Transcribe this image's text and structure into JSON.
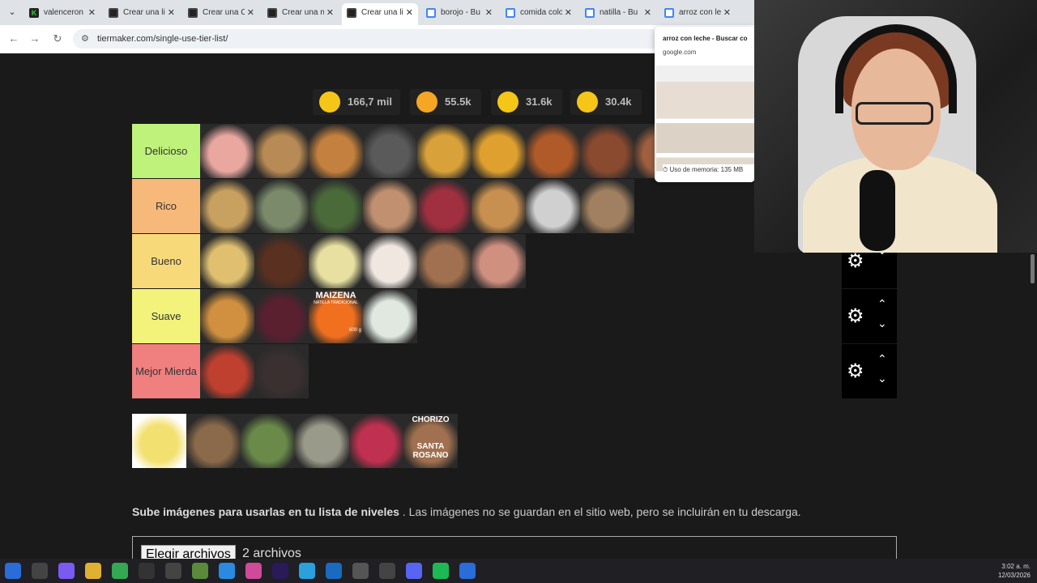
{
  "browser": {
    "tabs": [
      {
        "title": "valenceron",
        "favicon": "k-icon",
        "active": false
      },
      {
        "title": "Crear una li",
        "favicon": "tiermaker-icon",
        "active": false
      },
      {
        "title": "Crear una C",
        "favicon": "tiermaker-icon",
        "active": false
      },
      {
        "title": "Crear una n",
        "favicon": "tiermaker-icon",
        "active": false
      },
      {
        "title": "Crear una li",
        "favicon": "tiermaker-icon",
        "active": true
      },
      {
        "title": "borojo - Bu",
        "favicon": "google-icon",
        "active": false
      },
      {
        "title": "comida colo",
        "favicon": "google-icon",
        "active": false
      },
      {
        "title": "natilla - Bu",
        "favicon": "google-icon",
        "active": false
      },
      {
        "title": "arroz con le",
        "favicon": "google-icon",
        "active": false
      }
    ],
    "url": "tiermaker.com/single-use-tier-list/",
    "tab_preview": {
      "title": "arroz con leche - Buscar co",
      "domain": "google.com",
      "memory": "Uso de memoria: 135 MB"
    }
  },
  "reactions": [
    {
      "emoji": "smile-emoji-icon",
      "count": "166,7 mil",
      "color": "#f5c518"
    },
    {
      "emoji": "heart-eyes-emoji-icon",
      "count": "55.5k",
      "color": "#f5a623"
    },
    {
      "emoji": "laughing-emoji-icon",
      "count": "31.6k",
      "color": "#f5c518"
    },
    {
      "emoji": "raised-hands-emoji-icon",
      "count": "30.4k",
      "color": "#f5c518"
    }
  ],
  "tiers": [
    {
      "label": "Delicioso",
      "color": "#bff27a",
      "items": 9
    },
    {
      "label": "Rico",
      "color": "#f7b97a",
      "items": 8
    },
    {
      "label": "Bueno",
      "color": "#f7d97a",
      "items": 6
    },
    {
      "label": "Suave",
      "color": "#f3f27a",
      "items": 4
    },
    {
      "label": "Mejor Mierda",
      "color": "#f07f7f",
      "items": 2
    }
  ],
  "tier_controls": {
    "gear": "⚙",
    "up": "⌃",
    "down": "⌄"
  },
  "upload": {
    "bold": "Sube imágenes para usarlas en tu lista de niveles",
    "text": " . Las imágenes no se guardan en el sitio web, pero se incluirán en tu descarga.",
    "button": "Elegir archivos",
    "count": "2 archivos"
  },
  "pool_badge": {
    "line1": "CHORIZO",
    "line2": "SANTA",
    "line3": "ROSANO"
  },
  "food_badge": {
    "brand": "MAIZENA",
    "sub": "NATILLA TRADICIONAL",
    "weight": "600 g"
  },
  "nav": {
    "back": "←",
    "forward": "→",
    "reload": "↻",
    "menu": "⌄"
  },
  "taskbar": {
    "time": "3:02 a. m.",
    "date": "12/03/2026"
  }
}
